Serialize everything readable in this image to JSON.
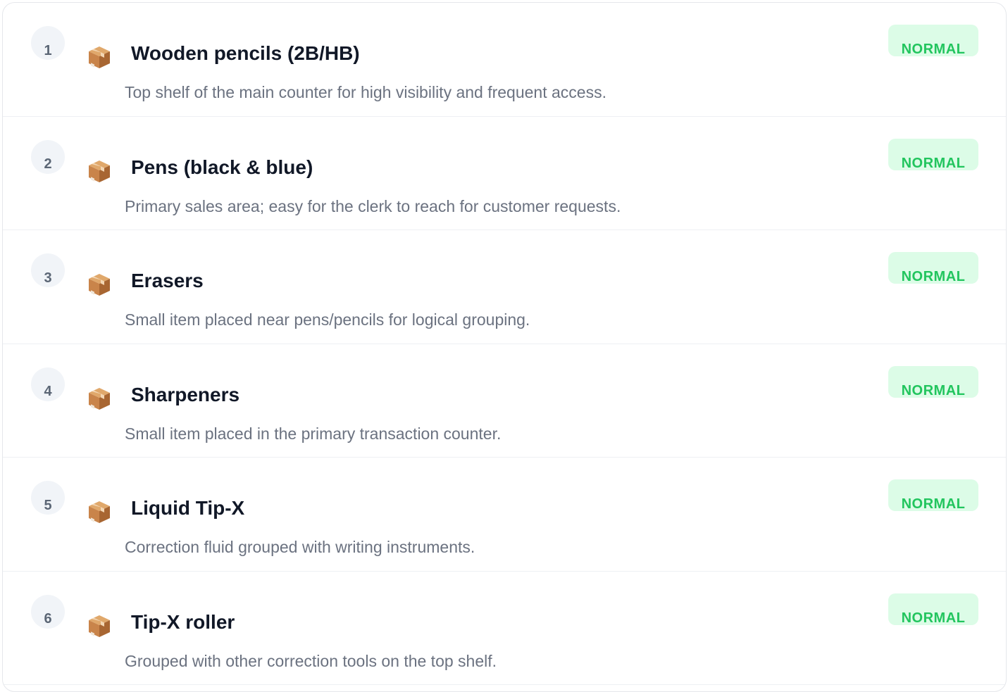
{
  "items": [
    {
      "number": "1",
      "title": "Wooden pencils (2B/HB)",
      "description": "Top shelf of the main counter for high visibility and frequent access.",
      "status": "NORMAL",
      "icon": "package-icon"
    },
    {
      "number": "2",
      "title": "Pens (black & blue)",
      "description": "Primary sales area; easy for the clerk to reach for customer requests.",
      "status": "NORMAL",
      "icon": "package-icon"
    },
    {
      "number": "3",
      "title": "Erasers",
      "description": "Small item placed near pens/pencils for logical grouping.",
      "status": "NORMAL",
      "icon": "package-icon"
    },
    {
      "number": "4",
      "title": "Sharpeners",
      "description": "Small item placed in the primary transaction counter.",
      "status": "NORMAL",
      "icon": "package-icon"
    },
    {
      "number": "5",
      "title": "Liquid Tip-X",
      "description": "Correction fluid grouped with writing instruments.",
      "status": "NORMAL",
      "icon": "package-icon"
    },
    {
      "number": "6",
      "title": "Tip-X roller",
      "description": "Grouped with other correction tools on the top shelf.",
      "status": "NORMAL",
      "icon": "package-icon"
    }
  ],
  "colors": {
    "badge_bg": "#dcfce7",
    "badge_text": "#22c55e",
    "title_text": "#111827",
    "description_text": "#6b7280"
  }
}
